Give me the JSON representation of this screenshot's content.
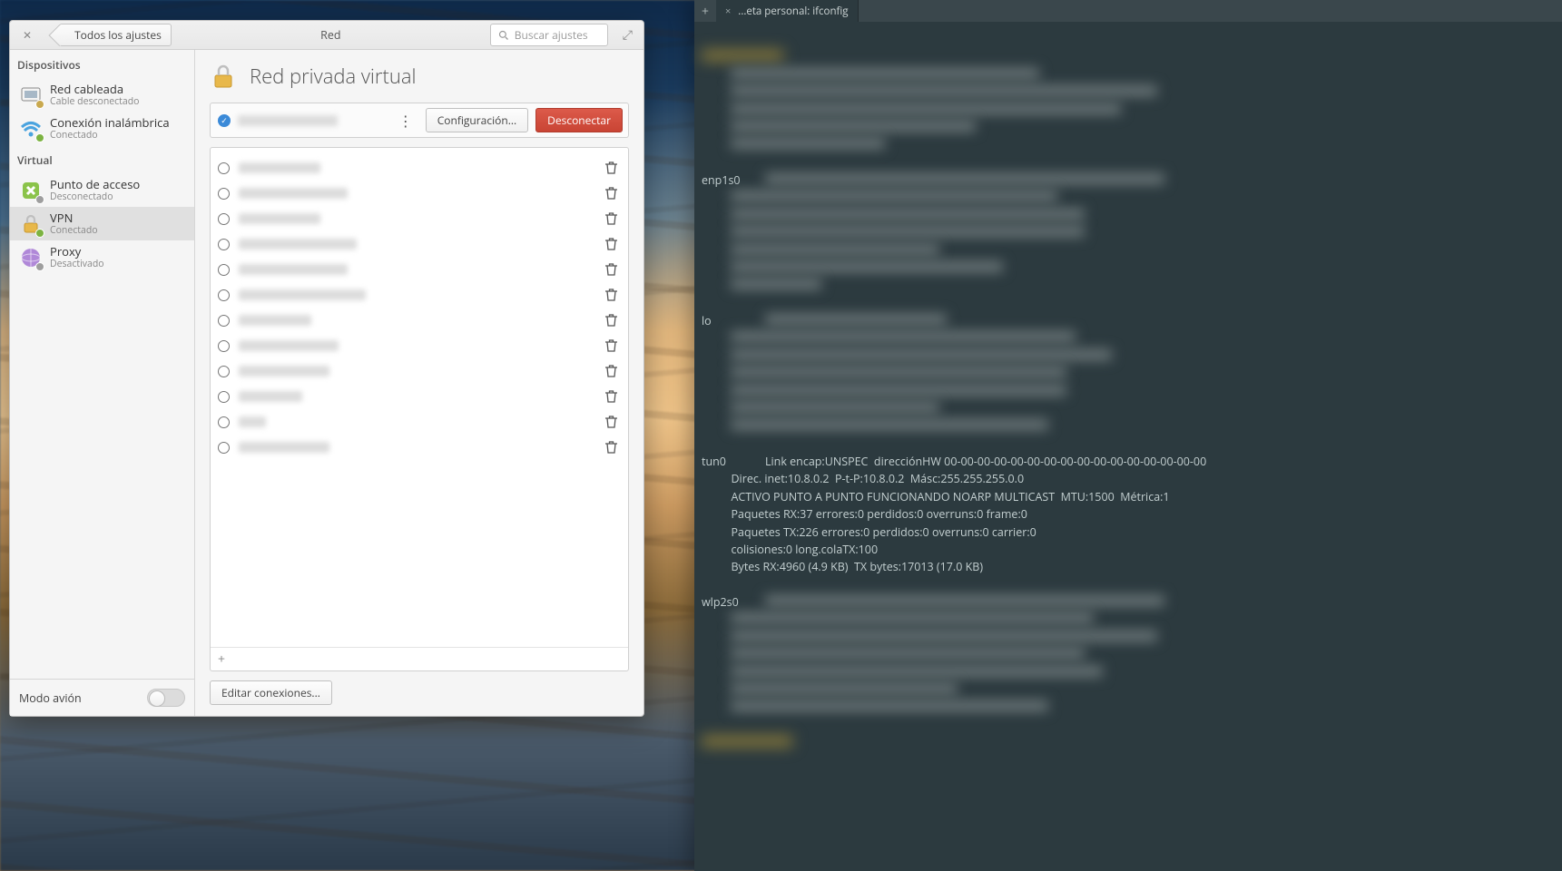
{
  "window": {
    "back_label": "Todos los ajustes",
    "title": "Red",
    "search_placeholder": "Buscar ajustes"
  },
  "sidebar": {
    "section_devices": "Dispositivos",
    "section_virtual": "Virtual",
    "items": [
      {
        "title": "Red cableada",
        "sub": "Cable desconectado"
      },
      {
        "title": "Conexión inalámbrica",
        "sub": "Conectado"
      },
      {
        "title": "Punto de acceso",
        "sub": "Desconectado"
      },
      {
        "title": "VPN",
        "sub": "Conectado"
      },
      {
        "title": "Proxy",
        "sub": "Desactivado"
      }
    ],
    "airplane": "Modo avión"
  },
  "vpn": {
    "heading": "Red privada virtual",
    "config_btn": "Configuración...",
    "disconnect_btn": "Desconectar",
    "edit_btn": "Editar conexiones...",
    "connections_count": 12
  },
  "terminal": {
    "tab_title": "...eta personal: ifconfig",
    "ifaces": [
      "enp1s0",
      "lo",
      "tun0",
      "wlp2s0"
    ],
    "tun0_lines": [
      "Link encap:UNSPEC  direcciónHW 00-00-00-00-00-00-00-00-00-00-00-00-00-00-00-00",
      "Direc. inet:10.8.0.2  P-t-P:10.8.0.2  Másc:255.255.255.0.0",
      "ACTIVO PUNTO A PUNTO FUNCIONANDO NOARP MULTICAST  MTU:1500  Métrica:1",
      "Paquetes RX:37 errores:0 perdidos:0 overruns:0 frame:0",
      "Paquetes TX:226 errores:0 perdidos:0 overruns:0 carrier:0",
      "colisiones:0 long.colaTX:100",
      "Bytes RX:4960 (4.9 KB)  TX bytes:17013 (17.0 KB)"
    ]
  }
}
